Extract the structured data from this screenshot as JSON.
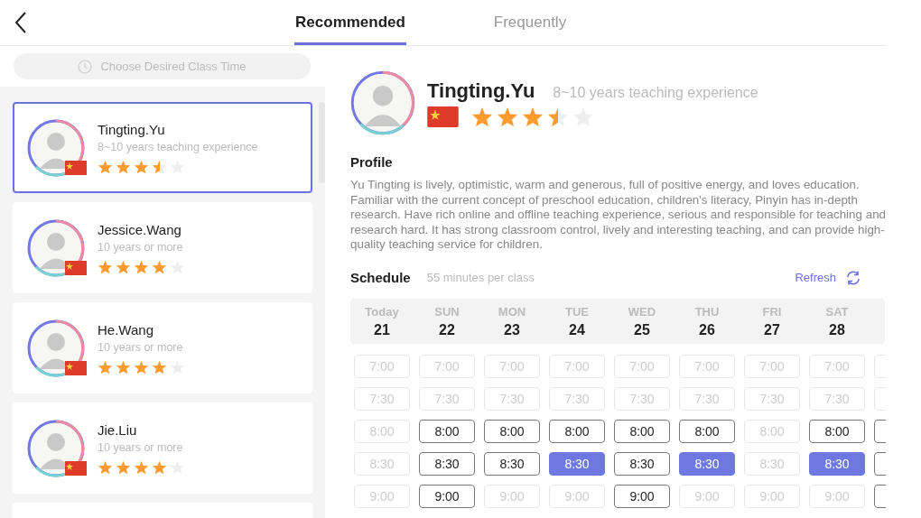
{
  "tabs": [
    {
      "label": "Recommended",
      "selected": true
    },
    {
      "label": "Frequently",
      "selected": false
    }
  ],
  "time_filter": {
    "placeholder": "Choose Desired Class Time"
  },
  "teachers": [
    {
      "name": "Tingting.Yu",
      "experience": "8~10 years teaching experience",
      "stars": 3.5,
      "selected": true
    },
    {
      "name": "Jessice.Wang",
      "experience": "10 years or more",
      "stars": 4,
      "selected": false
    },
    {
      "name": "He.Wang",
      "experience": "10 years or more",
      "stars": 4,
      "selected": false
    },
    {
      "name": "Jie.Liu",
      "experience": "10 years or more",
      "stars": 4,
      "selected": false
    }
  ],
  "detail": {
    "name": "Tingting.Yu",
    "experience": "8~10 years teaching experience",
    "stars": 3.5,
    "profile_title": "Profile",
    "profile": "Yu Tingting is lively, optimistic, warm and generous, full of positive energy, and loves education. Familiar with the current concept of preschool education, children's literacy, Pinyin has in-depth research. Have rich online and offline teaching experience, serious and responsible for teaching and research hard. It has strong classroom control, lively and interesting teaching, and can provide high-quality teaching service for children."
  },
  "schedule": {
    "title": "Schedule",
    "note": "55 minutes per class",
    "refresh": "Refresh",
    "days": [
      {
        "weekday": "Today",
        "date": "21",
        "slots": [
          {
            "time": "7:00",
            "available": false,
            "selected": false
          },
          {
            "time": "7:30",
            "available": false,
            "selected": false
          },
          {
            "time": "8:00",
            "available": false,
            "selected": false
          },
          {
            "time": "8:30",
            "available": false,
            "selected": false
          },
          {
            "time": "9:00",
            "available": false,
            "selected": false
          }
        ]
      },
      {
        "weekday": "SUN",
        "date": "22",
        "slots": [
          {
            "time": "7:00",
            "available": false,
            "selected": false
          },
          {
            "time": "7:30",
            "available": false,
            "selected": false
          },
          {
            "time": "8:00",
            "available": true,
            "selected": false
          },
          {
            "time": "8:30",
            "available": true,
            "selected": false
          },
          {
            "time": "9:00",
            "available": true,
            "selected": false
          }
        ]
      },
      {
        "weekday": "MON",
        "date": "23",
        "slots": [
          {
            "time": "7:00",
            "available": false,
            "selected": false
          },
          {
            "time": "7:30",
            "available": false,
            "selected": false
          },
          {
            "time": "8:00",
            "available": true,
            "selected": false
          },
          {
            "time": "8:30",
            "available": true,
            "selected": false
          },
          {
            "time": "9:00",
            "available": false,
            "selected": false
          }
        ]
      },
      {
        "weekday": "TUE",
        "date": "24",
        "slots": [
          {
            "time": "7:00",
            "available": false,
            "selected": false
          },
          {
            "time": "7:30",
            "available": false,
            "selected": false
          },
          {
            "time": "8:00",
            "available": true,
            "selected": false
          },
          {
            "time": "8:30",
            "available": true,
            "selected": true
          },
          {
            "time": "9:00",
            "available": false,
            "selected": false
          }
        ]
      },
      {
        "weekday": "WED",
        "date": "25",
        "slots": [
          {
            "time": "7:00",
            "available": false,
            "selected": false
          },
          {
            "time": "7:30",
            "available": false,
            "selected": false
          },
          {
            "time": "8:00",
            "available": true,
            "selected": false
          },
          {
            "time": "8:30",
            "available": true,
            "selected": false
          },
          {
            "time": "9:00",
            "available": true,
            "selected": false
          }
        ]
      },
      {
        "weekday": "THU",
        "date": "26",
        "slots": [
          {
            "time": "7:00",
            "available": false,
            "selected": false
          },
          {
            "time": "7:30",
            "available": false,
            "selected": false
          },
          {
            "time": "8:00",
            "available": true,
            "selected": false
          },
          {
            "time": "8:30",
            "available": true,
            "selected": true
          },
          {
            "time": "9:00",
            "available": false,
            "selected": false
          }
        ]
      },
      {
        "weekday": "FRI",
        "date": "27",
        "slots": [
          {
            "time": "7:00",
            "available": false,
            "selected": false
          },
          {
            "time": "7:30",
            "available": false,
            "selected": false
          },
          {
            "time": "8:00",
            "available": false,
            "selected": false
          },
          {
            "time": "8:30",
            "available": false,
            "selected": false
          },
          {
            "time": "9:00",
            "available": false,
            "selected": false
          }
        ]
      },
      {
        "weekday": "SAT",
        "date": "28",
        "slots": [
          {
            "time": "7:00",
            "available": false,
            "selected": false
          },
          {
            "time": "7:30",
            "available": false,
            "selected": false
          },
          {
            "time": "8:00",
            "available": true,
            "selected": false
          },
          {
            "time": "8:30",
            "available": true,
            "selected": true
          },
          {
            "time": "9:00",
            "available": false,
            "selected": false
          }
        ]
      },
      {
        "slots": [
          {
            "available": false,
            "selected": false
          },
          {
            "available": false,
            "selected": false
          },
          {
            "available": true,
            "selected": false
          },
          {
            "available": true,
            "selected": false
          },
          {
            "available": true,
            "selected": false
          }
        ]
      }
    ]
  }
}
